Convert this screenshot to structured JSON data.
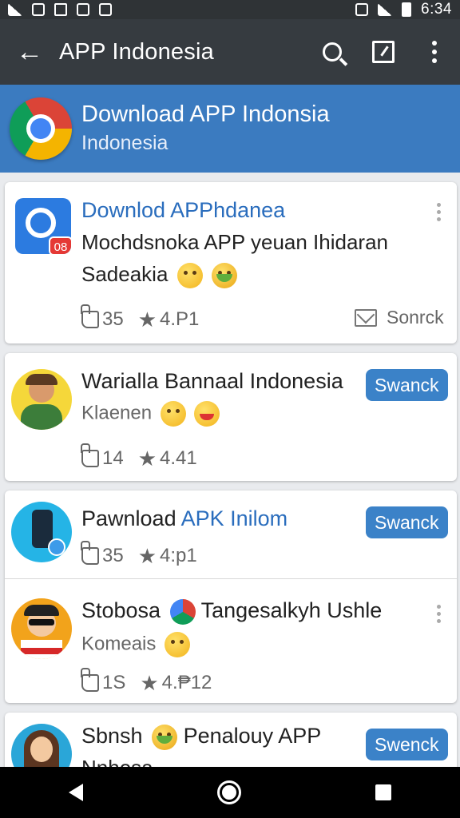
{
  "status_bar": {
    "time": "6:34"
  },
  "app_bar": {
    "title": "APP Indonesia"
  },
  "hero": {
    "title": "Download APP Indonsia",
    "subtitle": "Indonesia"
  },
  "items": [
    {
      "title": "Downlod APPhdanea",
      "line2": "Mochdsnoka APP yeuan Ihidaran",
      "line3": "Sadeakia",
      "badge": "08",
      "likes": "35",
      "rating": "4.P1",
      "action": "Sonrck"
    },
    {
      "title": "Warialla Bannaal Indonesia",
      "subtitle": "Klaenen",
      "likes": "14",
      "rating": "4.41",
      "button": "Swanck"
    },
    {
      "title_plain": "Pawnload ",
      "title_link": "APK Inilom",
      "likes": "35",
      "rating": "4:p1",
      "button": "Swanck"
    },
    {
      "title_a": "Stobosa",
      "title_b": "Tangesalkyh Ushle",
      "subtitle": "Komeais",
      "likes": "1S",
      "rating": "4.₱12"
    },
    {
      "title_a": "Sbnsh",
      "title_b": "Penalouy APP",
      "line2": "Nnhosa",
      "button": "Swenck"
    }
  ],
  "colors": {
    "app_bar": "#363b40",
    "hero": "#3b7bc0",
    "accent": "#3b82c8",
    "link": "#2a6dbd"
  }
}
